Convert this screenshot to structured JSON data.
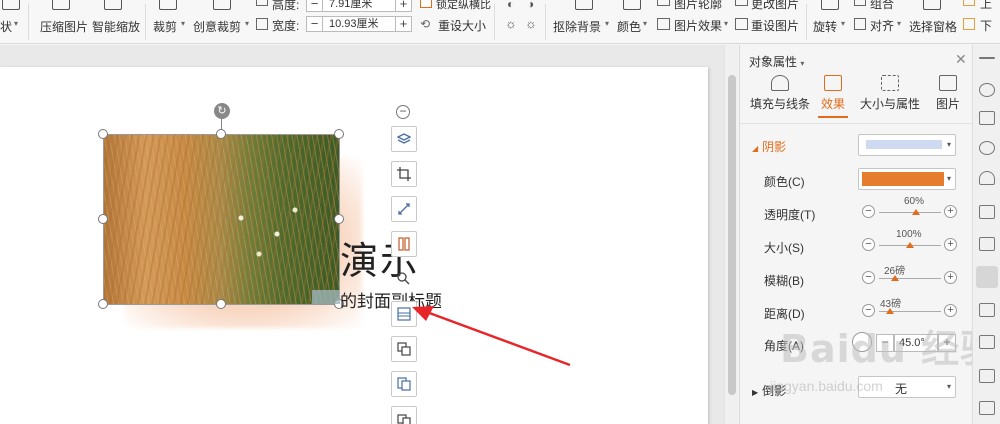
{
  "ribbon": {
    "shape_label": "状",
    "compress": "压缩图片",
    "smart_zoom": "智能缩放",
    "crop": "裁剪",
    "crop_caret": "▾",
    "creative_crop": "创意裁剪",
    "height_label": "高度:",
    "height_value": "7.91厘米",
    "width_label": "宽度:",
    "width_value": "10.93厘米",
    "lock_ratio": "锁定纵横比",
    "resize": "重设大小",
    "remove_bg": "抠除背景",
    "color": "颜色",
    "pic_outline": "图片轮廓",
    "pic_effect": "图片效果",
    "change_pic": "更改图片",
    "reset_pic": "重设图片",
    "rotate": "旋转",
    "combine": "组合",
    "align": "对齐",
    "select_pane": "选择窗格",
    "up": "上",
    "down": "下"
  },
  "slide": {
    "title": "演示",
    "subtitle": "的封面副标题"
  },
  "panel": {
    "header": "对象属性",
    "tabs": [
      {
        "label": "填充与线条"
      },
      {
        "label": "效果"
      },
      {
        "label": "大小与属性"
      },
      {
        "label": "图片"
      }
    ],
    "section": "阴影",
    "color_label": "颜色(C)",
    "transparency_label": "透明度(T)",
    "transparency_value": "60%",
    "transparency_pct": 60,
    "size_label": "大小(S)",
    "size_value": "100%",
    "size_pct": 50,
    "blur_label": "模糊(B)",
    "blur_value": "26磅",
    "blur_pct": 26,
    "distance_label": "距离(D)",
    "distance_value": "43磅",
    "distance_pct": 17,
    "angle_label": "角度(A)",
    "angle_value": "45.0°",
    "reflection_label": "倒影",
    "reflection_value": "无",
    "shadow_color": "#e67c2e",
    "preset_color": "#cfdaf2"
  },
  "watermark": {
    "brand": "Baidu 经验",
    "url": "jingyan.baidu.com"
  },
  "accent": "#e06d1d",
  "arrow_color": "#e8262a"
}
